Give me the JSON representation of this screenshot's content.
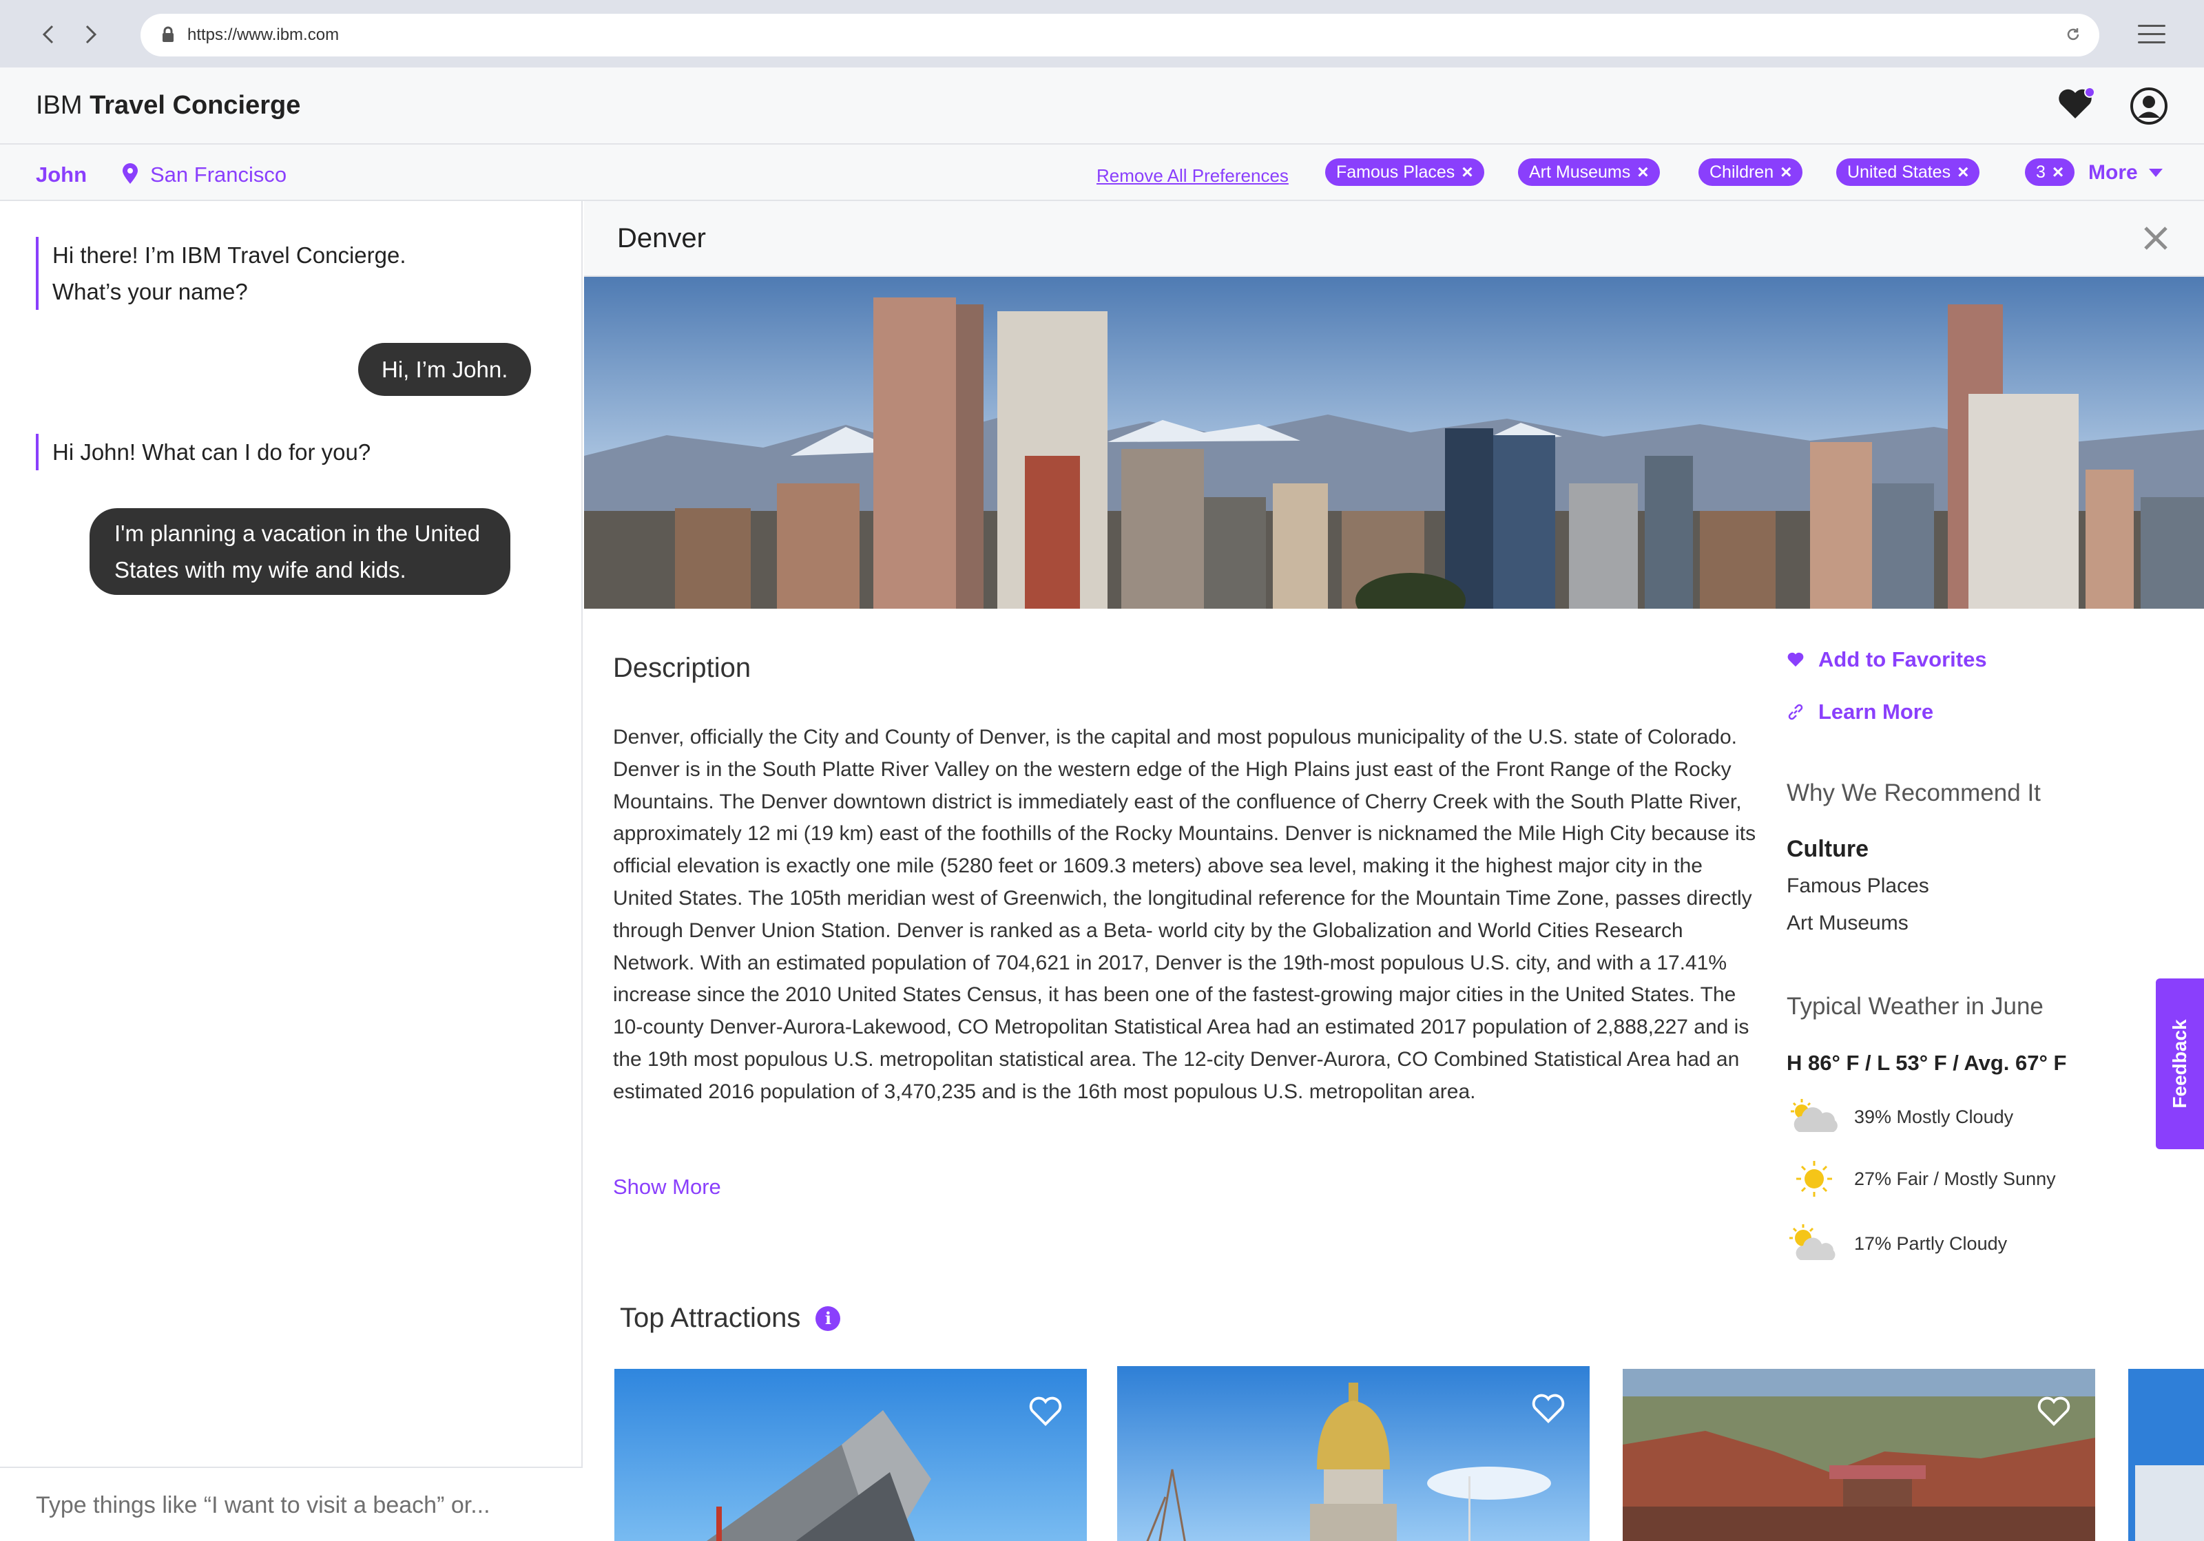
{
  "browser": {
    "url": "https://www.ibm.com"
  },
  "app": {
    "title_prefix": "IBM",
    "title_main": "Travel Concierge"
  },
  "prefs": {
    "user": "John",
    "location": "San Francisco",
    "remove_all": "Remove All Preferences",
    "chips": [
      "Famous Places",
      "Art Museums",
      "Children",
      "United States"
    ],
    "extra_count": "3",
    "more_label": "More"
  },
  "chat": {
    "bot_1": "Hi there! I’m IBM Travel Concierge.",
    "bot_1b": "What’s your name?",
    "user_1": "Hi, I’m John.",
    "bot_2": "Hi John! What can I do for you?",
    "user_2a": "I'm planning a vacation in the United",
    "user_2b": "States with my wife and kids.",
    "input_placeholder": "Type things like “I want to visit a beach” or..."
  },
  "detail": {
    "city": "Denver",
    "description_title": "Description",
    "description": "Denver, officially the City and County of Denver, is the capital and most populous municipality of the U.S. state of Colorado. Denver is in the South Platte River Valley on the western edge of the High Plains just east of the Front Range of the Rocky Mountains. The Denver downtown district is immediately east of the confluence of Cherry Creek with the South Platte River, approximately 12 mi (19 km) east of the foothills of the Rocky Mountains. Denver is nicknamed the Mile High City because its official elevation is exactly one mile (5280 feet or 1609.3 meters) above sea level, making it the highest major city in the United States. The 105th meridian west of Greenwich, the longitudinal reference for the Mountain Time Zone, passes directly through Denver Union Station. Denver is ranked as a Beta- world city by the Globalization and World Cities Research Network. With an estimated population of 704,621 in 2017, Denver is the 19th-most populous U.S. city, and with a 17.41% increase since the 2010 United States Census, it has been one of the fastest-growing major cities in the United States. The 10-county Denver-Aurora-Lakewood, CO Metropolitan Statistical Area had an estimated 2017 population of 2,888,227 and is the 19th most populous U.S. metropolitan statistical area. The 12-city Denver-Aurora, CO Combined Statistical Area had an estimated 2016 population of 3,470,235 and is the 16th most populous U.S. metropolitan area.",
    "show_more": "Show More",
    "add_favorites": "Add to Favorites",
    "learn_more": "Learn More",
    "why_title": "Why We Recommend It",
    "why_category": "Culture",
    "why_items": [
      "Famous Places",
      "Art Museums"
    ],
    "weather_title": "Typical Weather in June",
    "weather_summary": "H 86° F / L 53° F / Avg. 67° F",
    "weather": [
      {
        "label": "39% Mostly Cloudy",
        "icon": "mostly-cloudy-icon"
      },
      {
        "label": "27% Fair / Mostly Sunny",
        "icon": "sunny-icon"
      },
      {
        "label": "17% Partly Cloudy",
        "icon": "partly-cloudy-icon"
      }
    ],
    "attractions_title": "Top Attractions",
    "attractions": [
      "art-museum",
      "state-capitol",
      "red-rocks"
    ]
  },
  "feedback": "Feedback",
  "colors": {
    "accent": "#8a3ffc",
    "chat_bubble": "#333333",
    "chrome": "#dfe2ea"
  }
}
